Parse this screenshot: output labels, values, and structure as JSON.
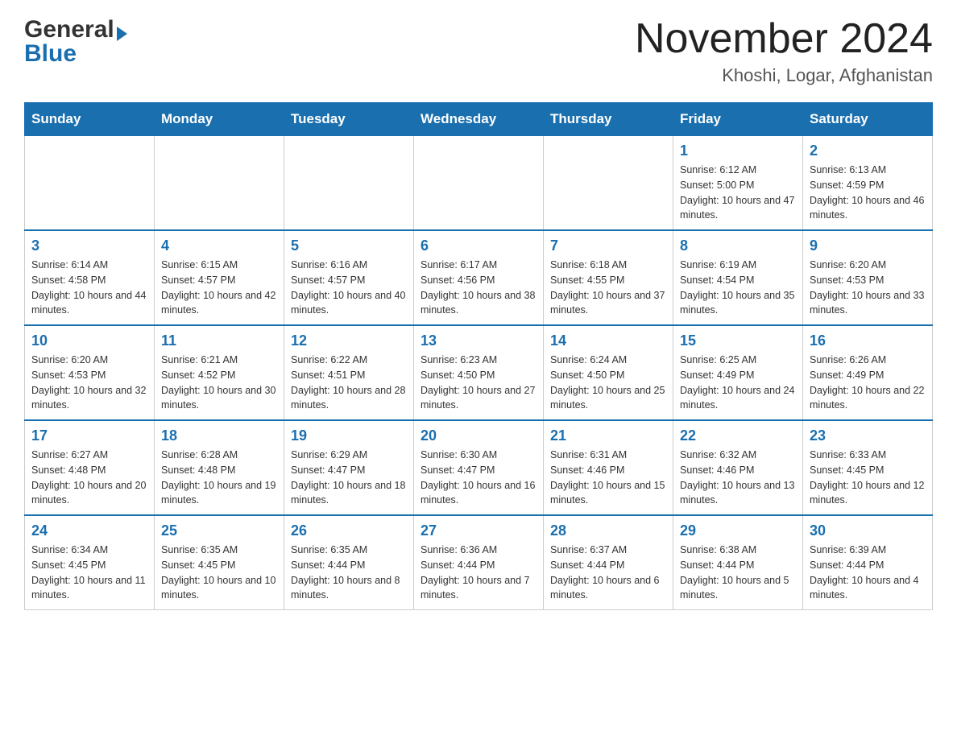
{
  "header": {
    "logo_general": "General",
    "logo_blue": "Blue",
    "month_title": "November 2024",
    "location": "Khoshi, Logar, Afghanistan"
  },
  "weekdays": [
    "Sunday",
    "Monday",
    "Tuesday",
    "Wednesday",
    "Thursday",
    "Friday",
    "Saturday"
  ],
  "weeks": [
    [
      {
        "day": "",
        "info": ""
      },
      {
        "day": "",
        "info": ""
      },
      {
        "day": "",
        "info": ""
      },
      {
        "day": "",
        "info": ""
      },
      {
        "day": "",
        "info": ""
      },
      {
        "day": "1",
        "info": "Sunrise: 6:12 AM\nSunset: 5:00 PM\nDaylight: 10 hours and 47 minutes."
      },
      {
        "day": "2",
        "info": "Sunrise: 6:13 AM\nSunset: 4:59 PM\nDaylight: 10 hours and 46 minutes."
      }
    ],
    [
      {
        "day": "3",
        "info": "Sunrise: 6:14 AM\nSunset: 4:58 PM\nDaylight: 10 hours and 44 minutes."
      },
      {
        "day": "4",
        "info": "Sunrise: 6:15 AM\nSunset: 4:57 PM\nDaylight: 10 hours and 42 minutes."
      },
      {
        "day": "5",
        "info": "Sunrise: 6:16 AM\nSunset: 4:57 PM\nDaylight: 10 hours and 40 minutes."
      },
      {
        "day": "6",
        "info": "Sunrise: 6:17 AM\nSunset: 4:56 PM\nDaylight: 10 hours and 38 minutes."
      },
      {
        "day": "7",
        "info": "Sunrise: 6:18 AM\nSunset: 4:55 PM\nDaylight: 10 hours and 37 minutes."
      },
      {
        "day": "8",
        "info": "Sunrise: 6:19 AM\nSunset: 4:54 PM\nDaylight: 10 hours and 35 minutes."
      },
      {
        "day": "9",
        "info": "Sunrise: 6:20 AM\nSunset: 4:53 PM\nDaylight: 10 hours and 33 minutes."
      }
    ],
    [
      {
        "day": "10",
        "info": "Sunrise: 6:20 AM\nSunset: 4:53 PM\nDaylight: 10 hours and 32 minutes."
      },
      {
        "day": "11",
        "info": "Sunrise: 6:21 AM\nSunset: 4:52 PM\nDaylight: 10 hours and 30 minutes."
      },
      {
        "day": "12",
        "info": "Sunrise: 6:22 AM\nSunset: 4:51 PM\nDaylight: 10 hours and 28 minutes."
      },
      {
        "day": "13",
        "info": "Sunrise: 6:23 AM\nSunset: 4:50 PM\nDaylight: 10 hours and 27 minutes."
      },
      {
        "day": "14",
        "info": "Sunrise: 6:24 AM\nSunset: 4:50 PM\nDaylight: 10 hours and 25 minutes."
      },
      {
        "day": "15",
        "info": "Sunrise: 6:25 AM\nSunset: 4:49 PM\nDaylight: 10 hours and 24 minutes."
      },
      {
        "day": "16",
        "info": "Sunrise: 6:26 AM\nSunset: 4:49 PM\nDaylight: 10 hours and 22 minutes."
      }
    ],
    [
      {
        "day": "17",
        "info": "Sunrise: 6:27 AM\nSunset: 4:48 PM\nDaylight: 10 hours and 20 minutes."
      },
      {
        "day": "18",
        "info": "Sunrise: 6:28 AM\nSunset: 4:48 PM\nDaylight: 10 hours and 19 minutes."
      },
      {
        "day": "19",
        "info": "Sunrise: 6:29 AM\nSunset: 4:47 PM\nDaylight: 10 hours and 18 minutes."
      },
      {
        "day": "20",
        "info": "Sunrise: 6:30 AM\nSunset: 4:47 PM\nDaylight: 10 hours and 16 minutes."
      },
      {
        "day": "21",
        "info": "Sunrise: 6:31 AM\nSunset: 4:46 PM\nDaylight: 10 hours and 15 minutes."
      },
      {
        "day": "22",
        "info": "Sunrise: 6:32 AM\nSunset: 4:46 PM\nDaylight: 10 hours and 13 minutes."
      },
      {
        "day": "23",
        "info": "Sunrise: 6:33 AM\nSunset: 4:45 PM\nDaylight: 10 hours and 12 minutes."
      }
    ],
    [
      {
        "day": "24",
        "info": "Sunrise: 6:34 AM\nSunset: 4:45 PM\nDaylight: 10 hours and 11 minutes."
      },
      {
        "day": "25",
        "info": "Sunrise: 6:35 AM\nSunset: 4:45 PM\nDaylight: 10 hours and 10 minutes."
      },
      {
        "day": "26",
        "info": "Sunrise: 6:35 AM\nSunset: 4:44 PM\nDaylight: 10 hours and 8 minutes."
      },
      {
        "day": "27",
        "info": "Sunrise: 6:36 AM\nSunset: 4:44 PM\nDaylight: 10 hours and 7 minutes."
      },
      {
        "day": "28",
        "info": "Sunrise: 6:37 AM\nSunset: 4:44 PM\nDaylight: 10 hours and 6 minutes."
      },
      {
        "day": "29",
        "info": "Sunrise: 6:38 AM\nSunset: 4:44 PM\nDaylight: 10 hours and 5 minutes."
      },
      {
        "day": "30",
        "info": "Sunrise: 6:39 AM\nSunset: 4:44 PM\nDaylight: 10 hours and 4 minutes."
      }
    ]
  ]
}
